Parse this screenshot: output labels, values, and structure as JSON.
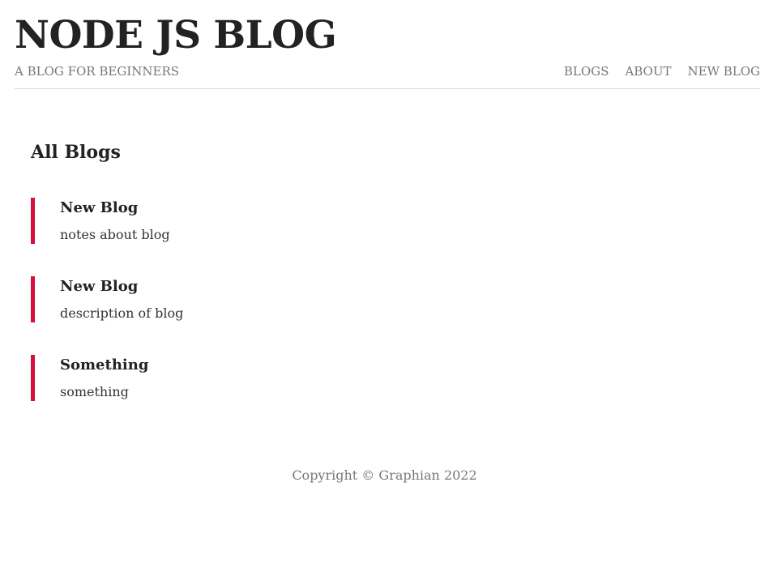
{
  "header": {
    "title": "NODE JS BLOG",
    "subtitle": "A BLOG FOR BEGINNERS"
  },
  "nav": {
    "items": [
      {
        "label": "BLOGS"
      },
      {
        "label": "ABOUT"
      },
      {
        "label": "NEW BLOG"
      }
    ]
  },
  "main": {
    "heading": "All Blogs",
    "blogs": [
      {
        "title": "New Blog",
        "snippet": "notes about blog"
      },
      {
        "title": "New Blog",
        "snippet": "description of blog"
      },
      {
        "title": "Something",
        "snippet": "something"
      }
    ]
  },
  "footer": {
    "copyright": "Copyright © Graphian 2022"
  },
  "colors": {
    "accent": "#d6103b",
    "text": "#222222",
    "muted": "#777777"
  }
}
